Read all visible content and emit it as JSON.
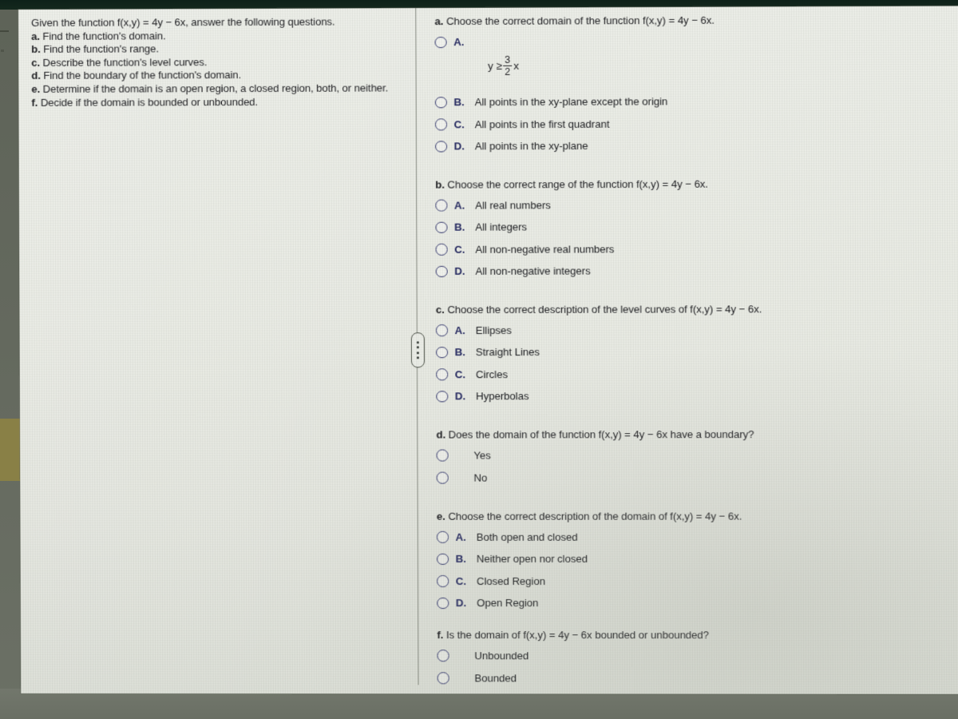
{
  "left_pane": {
    "intro": "Given the function f(x,y) = 4y − 6x, answer the following questions.",
    "items": [
      {
        "label": "a.",
        "text": "Find the function's domain."
      },
      {
        "label": "b.",
        "text": "Find the function's range."
      },
      {
        "label": "c.",
        "text": "Describe the function's level curves."
      },
      {
        "label": "d.",
        "text": "Find the boundary of the function's domain."
      },
      {
        "label": "e.",
        "text": "Determine if the domain is an open region, a closed region, both, or neither."
      },
      {
        "label": "f.",
        "text": "Decide if the domain is bounded or unbounded."
      }
    ]
  },
  "questions": [
    {
      "label": "a.",
      "stem": "Choose the correct domain of the function f(x,y) = 4y − 6x.",
      "options": [
        {
          "letter": "A.",
          "text": "",
          "math": {
            "lhs": "y ≥",
            "numerator": "3",
            "denominator": "2",
            "variable": "x"
          }
        },
        {
          "letter": "B.",
          "text": "All points in the xy-plane except the origin"
        },
        {
          "letter": "C.",
          "text": "All points in the first quadrant"
        },
        {
          "letter": "D.",
          "text": "All points in the xy-plane"
        }
      ]
    },
    {
      "label": "b.",
      "stem": "Choose the correct range of the function f(x,y) = 4y − 6x.",
      "options": [
        {
          "letter": "A.",
          "text": "All real numbers"
        },
        {
          "letter": "B.",
          "text": "All integers"
        },
        {
          "letter": "C.",
          "text": "All non-negative real numbers"
        },
        {
          "letter": "D.",
          "text": "All non-negative integers"
        }
      ]
    },
    {
      "label": "c.",
      "stem": "Choose the correct description of the level curves of f(x,y) = 4y − 6x.",
      "options": [
        {
          "letter": "A.",
          "text": "Ellipses"
        },
        {
          "letter": "B.",
          "text": "Straight Lines"
        },
        {
          "letter": "C.",
          "text": "Circles"
        },
        {
          "letter": "D.",
          "text": "Hyperbolas"
        }
      ]
    },
    {
      "label": "d.",
      "stem": "Does the domain of the function f(x,y) = 4y − 6x have a boundary?",
      "options": [
        {
          "letter": "",
          "text": "Yes"
        },
        {
          "letter": "",
          "text": "No"
        }
      ]
    },
    {
      "label": "e.",
      "stem": "Choose the correct description of the domain of f(x,y) = 4y − 6x.",
      "options": [
        {
          "letter": "A.",
          "text": "Both open and closed"
        },
        {
          "letter": "B.",
          "text": "Neither open nor closed"
        },
        {
          "letter": "C.",
          "text": "Closed Region"
        },
        {
          "letter": "D.",
          "text": "Open Region"
        }
      ]
    },
    {
      "label": "f.",
      "stem": "Is the domain of f(x,y) = 4y − 6x bounded or unbounded?",
      "options": [
        {
          "letter": "",
          "text": "Unbounded"
        },
        {
          "letter": "",
          "text": "Bounded"
        }
      ]
    }
  ],
  "splitter": {
    "dots": 4
  },
  "colors": {
    "screen_background": "#eceee8",
    "text": "#1c1c20",
    "radio_outline": "#31356b",
    "option_letter": "#22265f",
    "divider": "#6d7268",
    "photo_top_band": "#14281d",
    "desk": "#6b7065",
    "sticky_note": "#8b8244"
  }
}
